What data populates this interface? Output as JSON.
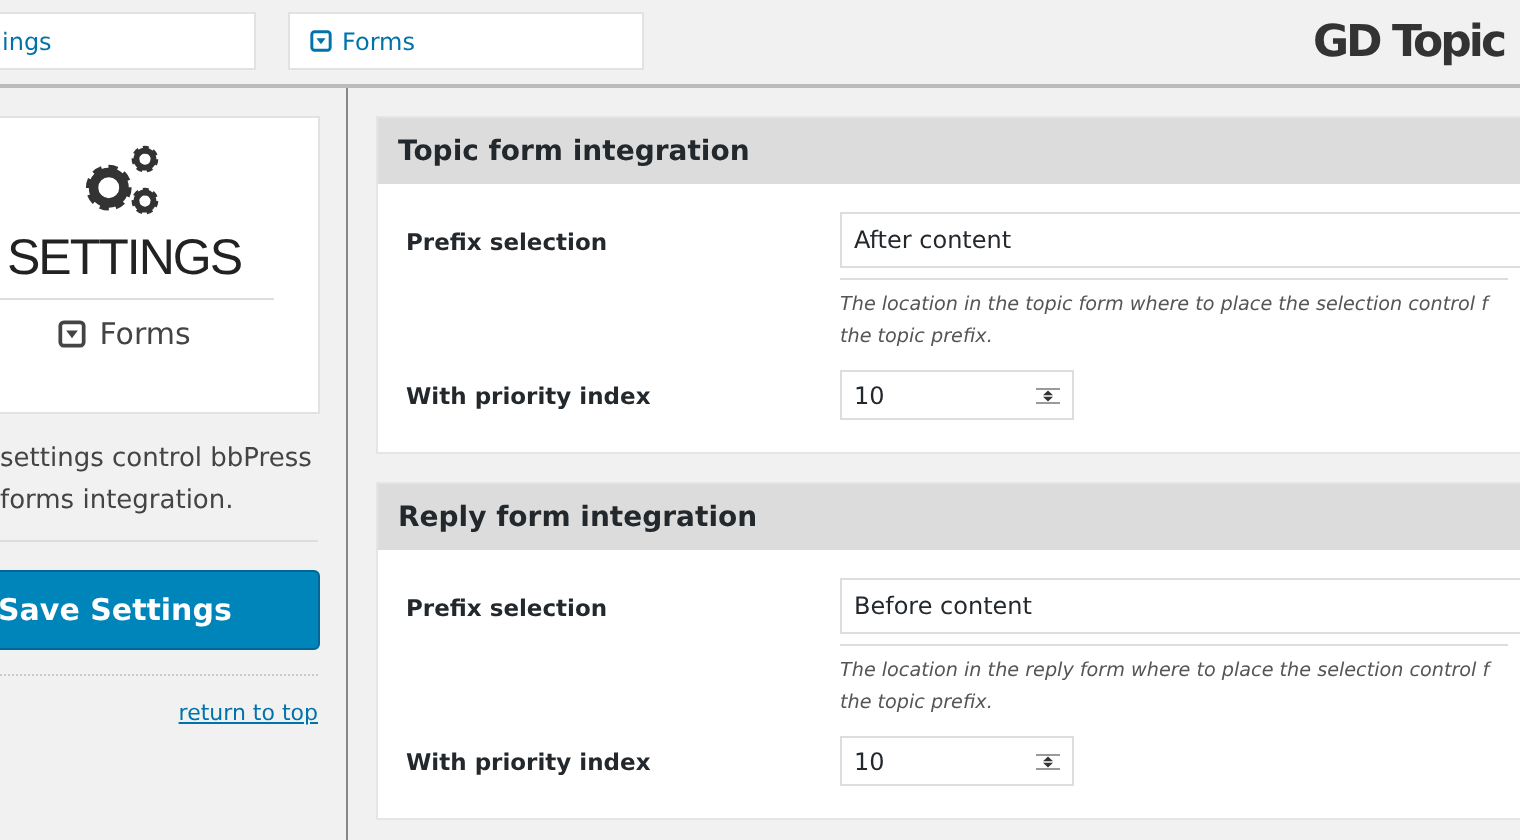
{
  "tabs": [
    {
      "label": "ings",
      "icon": false
    },
    {
      "label": "Forms",
      "icon": true
    }
  ],
  "brand": "GD Topic",
  "sidebar": {
    "title": "SETTINGS",
    "section": "Forms",
    "description": "settings control bbPress forms integration.",
    "save_button": "Save Settings",
    "return_link": "return to top"
  },
  "panels": [
    {
      "title": "Topic form integration",
      "prefix_label": "Prefix selection",
      "prefix_value": "After content",
      "description": "The location in the topic form where to place the selection control f the topic prefix.",
      "priority_label": "With priority index",
      "priority_value": "10"
    },
    {
      "title": "Reply form integration",
      "prefix_label": "Prefix selection",
      "prefix_value": "Before content",
      "description": "The location in the reply form where to place the selection control f the topic prefix.",
      "priority_label": "With priority index",
      "priority_value": "10"
    }
  ]
}
